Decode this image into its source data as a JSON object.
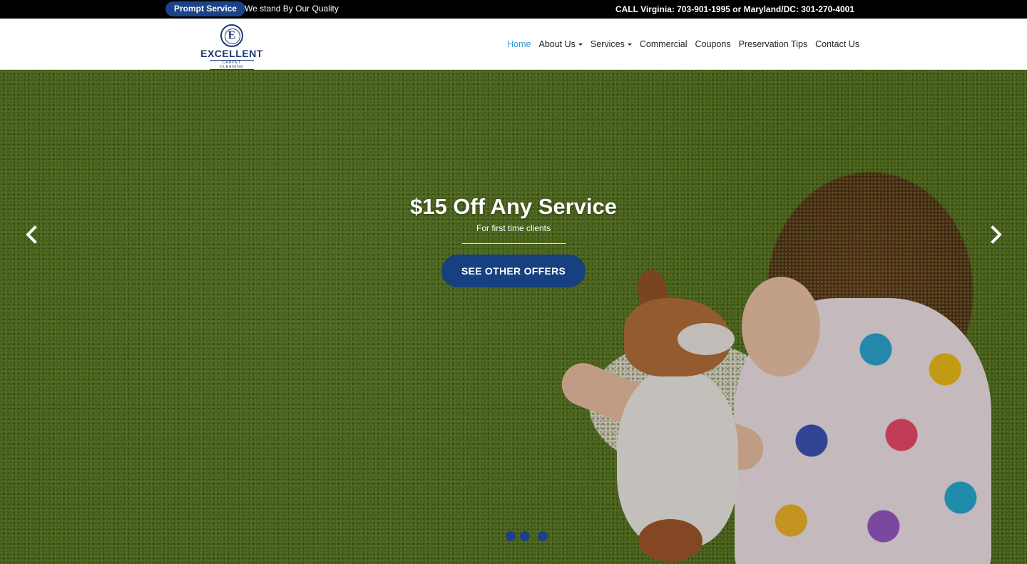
{
  "topbar": {
    "pill_label": "Prompt Service",
    "tagline": "We stand By Our Quality",
    "phone_text": "CALL Virginia: 703-901-1995 or Maryland/DC: 301-270-4001"
  },
  "logo": {
    "letter": "E",
    "name": "EXCELLENT",
    "sub": "CARPET CLEANING"
  },
  "nav": {
    "items": [
      {
        "label": "Home",
        "active": true
      },
      {
        "label": "About Us",
        "dropdown": true
      },
      {
        "label": "Services",
        "dropdown": true
      },
      {
        "label": "Commercial"
      },
      {
        "label": "Coupons"
      },
      {
        "label": "Preservation Tips"
      },
      {
        "label": "Contact Us"
      }
    ]
  },
  "hero": {
    "title": "$15 Off Any Service",
    "subtitle": "For first time clients",
    "cta_label": "SEE OTHER OFFERS",
    "slide_count": 3,
    "icons": {
      "prev": "chevron-left-icon",
      "next": "chevron-right-icon"
    }
  },
  "colors": {
    "brand_blue": "#16407f",
    "nav_active": "#2d9fd6",
    "topbar_bg": "#000000"
  }
}
